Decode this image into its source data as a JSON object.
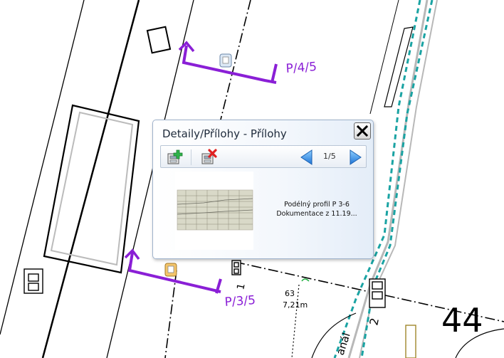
{
  "map": {
    "section_labels": [
      "P/4/5",
      "P/3/5"
    ],
    "measure_number": "63",
    "measure_length": "7,21m",
    "parcel_number": "44",
    "digit_one": "1",
    "digit_two": "2",
    "street_fragment": "anál",
    "colors": {
      "section_purple": "#8a1fd6",
      "water_teal": "#1aa3a3",
      "grey": "#b8b8b8"
    }
  },
  "popup": {
    "title": "Detaily/Přílohy - Přílohy",
    "pager": "1/5",
    "caption_line1": "Podélný profil P 3-6",
    "caption_line2": "Dokumentace z 11.19...",
    "icons": {
      "add": "add-attachment-icon",
      "delete": "delete-attachment-icon",
      "prev": "prev-arrow-icon",
      "next": "next-arrow-icon",
      "close": "close-x-icon"
    }
  }
}
